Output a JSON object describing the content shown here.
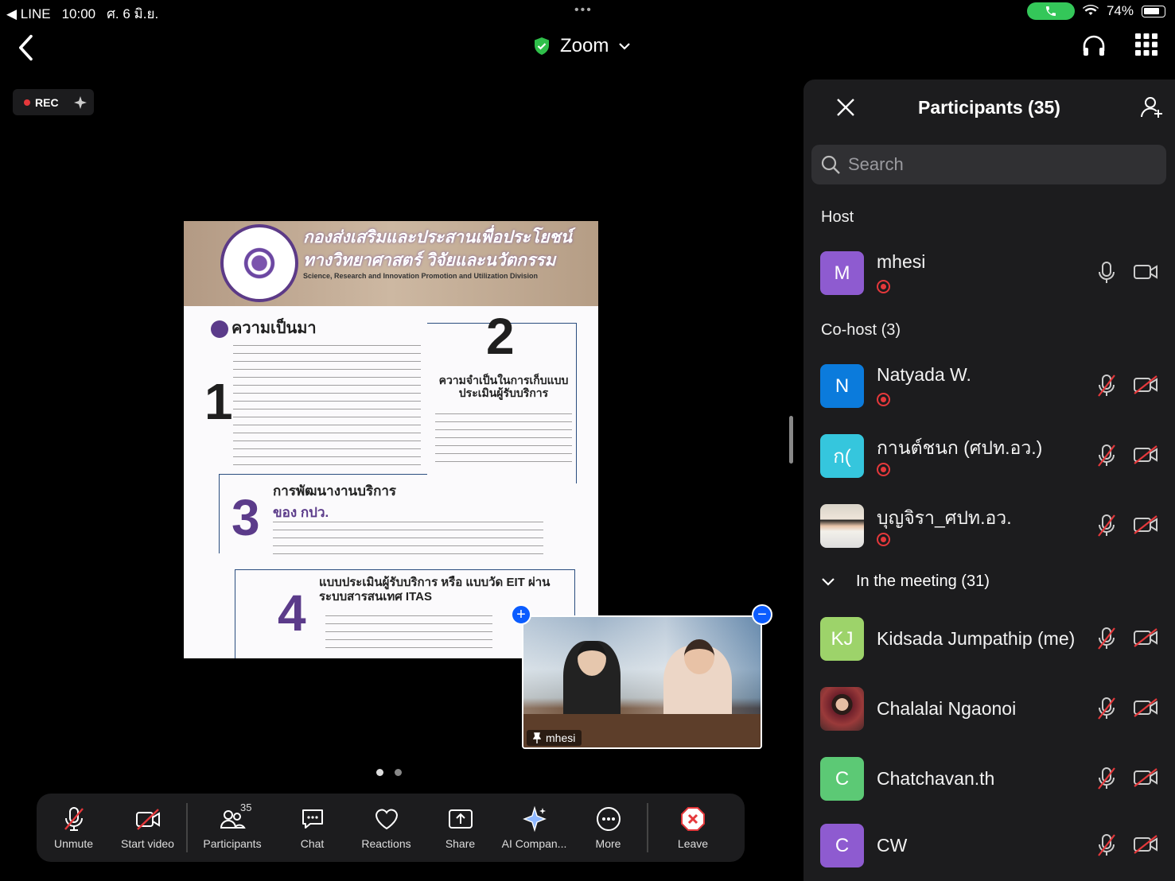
{
  "status_bar": {
    "back_app": "◀ LINE",
    "time": "10:00",
    "date": "ศ. 6 มิ.ย.",
    "battery": "74%"
  },
  "header": {
    "title": "Zoom"
  },
  "recording": {
    "label": "REC"
  },
  "shared_doc": {
    "title_line1": "กองส่งเสริมและประสานเพื่อประโยชน์",
    "title_line2": "ทางวิทยาศาสตร์ วิจัยและนวัตกรรม",
    "subtitle": "Science, Research and Innovation Promotion and Utilization Division",
    "sec_background": "ความเป็นมา",
    "num1": "1",
    "num2": "2",
    "sec2_title": "ความจำเป็นในการเก็บแบบประเมินผู้รับบริการ",
    "num3": "3",
    "sec3_title_a": "การพัฒนางานบริการ",
    "sec3_title_b": "ของ กปว.",
    "num4": "4",
    "sec4_title": "แบบประเมินผู้รับบริการ หรือ แบบวัด EIT ผ่านระบบสารสนเทศ ITAS"
  },
  "self_view": {
    "name": "mhesi"
  },
  "toolbar": {
    "unmute": "Unmute",
    "start_video": "Start video",
    "participants": "Participants",
    "participants_count": "35",
    "chat": "Chat",
    "reactions": "Reactions",
    "share": "Share",
    "ai_companion": "AI Compan...",
    "more": "More",
    "leave": "Leave"
  },
  "panel": {
    "title": "Participants (35)",
    "search_placeholder": "Search",
    "host_label": "Host",
    "cohost_label": "Co-host (3)",
    "meeting_label": "In the meeting (31)",
    "host": {
      "name": "mhesi",
      "initial": "M",
      "color": "#8e5bd0"
    },
    "cohosts": [
      {
        "name": "Natyada W.",
        "initial": "N",
        "color": "#0b7bdc"
      },
      {
        "name": "กานต์ชนก (ศปท.อว.)",
        "initial": "ก(",
        "color": "#35c6dd"
      },
      {
        "name": "บุญจิรา_ศปท.อว.",
        "initial": "",
        "color": "#ccc"
      }
    ],
    "members": [
      {
        "name": "Kidsada Jumpathip (me)",
        "initial": "KJ",
        "color": "#9dd36a"
      },
      {
        "name": "Chalalai Ngaonoi",
        "initial": "",
        "color": "#7a2a2a"
      },
      {
        "name": "Chatchavan.th",
        "initial": "C",
        "color": "#5cc975"
      },
      {
        "name": "CW",
        "initial": "C",
        "color": "#8e5bd0"
      }
    ]
  }
}
